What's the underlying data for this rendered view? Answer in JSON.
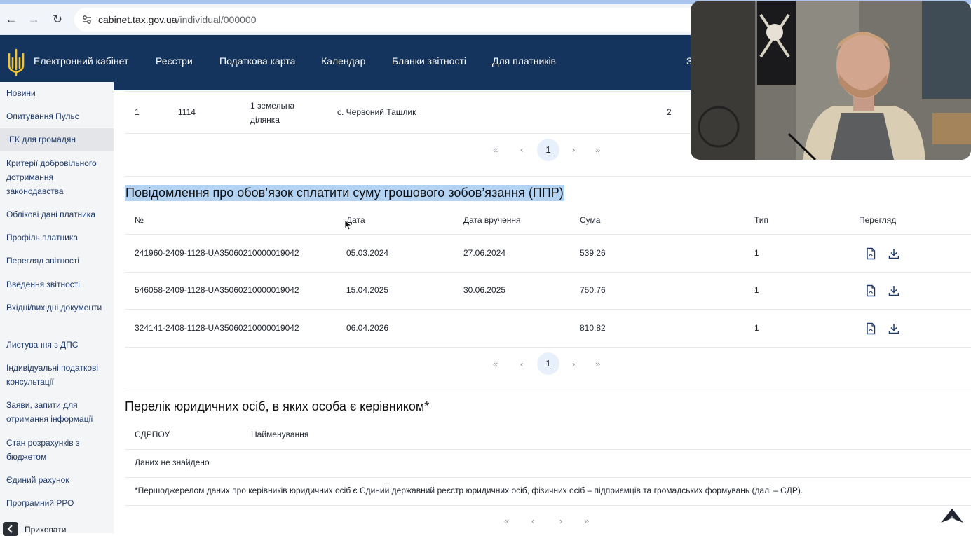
{
  "browser": {
    "url_host": "cabinet.tax.gov.ua",
    "url_path": "/individual/000000"
  },
  "header": {
    "brand": "Електронний кабінет",
    "nav": [
      "Реєстри",
      "Податкова карта",
      "Календар",
      "Бланки звітності",
      "Для платників"
    ],
    "cut_char": "З"
  },
  "sidebar": {
    "items": [
      "Новини",
      "Опитування Пульс",
      "ЕК для громадян",
      "Критерії добровільного дотримання законодавства",
      "Облікові дані платника",
      "Профіль платника",
      "Перегляд звітності",
      "Введення звітності",
      "Вхідні/вихідні документи",
      "Листування з ДПС",
      "Індивідуальні податкові консультації",
      "Заяви, запити для отримання інформації",
      "Стан розрахунків з бюджетом",
      "Єдиний рахунок",
      "Програмний РРО"
    ],
    "active_index": 2,
    "hide_label": "Приховати"
  },
  "land_table": {
    "row": [
      "1",
      "1114",
      "1 земельна ділянка",
      "с. Червоний Ташлик",
      "2"
    ],
    "page": "1"
  },
  "ppr": {
    "title": "Повідомлення про обов’язок сплатити суму грошового зобов’язання (ППР)",
    "headers": [
      "№",
      "Дата",
      "Дата вручення",
      "Сума",
      "Тип",
      "Перегляд"
    ],
    "rows": [
      [
        "241960-2409-1128-UA35060210000019042",
        "05.03.2024",
        "27.06.2024",
        "539.26",
        "1"
      ],
      [
        "546058-2409-1128-UA35060210000019042",
        "15.04.2025",
        "30.06.2025",
        "750.76",
        "1"
      ],
      [
        "324141-2408-1128-UA35060210000019042",
        "06.04.2026",
        "",
        "810.82",
        "1"
      ]
    ],
    "page": "1"
  },
  "entities": {
    "title": "Перелік юридичних осіб, в яких особа є керівником*",
    "headers": [
      "ЄДРПОУ",
      "Найменування"
    ],
    "empty": "Даних не знайдено",
    "footnote": "*Першоджерелом даних про керівників юридичних осіб є Єдиний державний реєстр юридичних осіб, фізичних осіб – підприємців та громадських формувань (далі – ЄДР)."
  },
  "pager_glyphs": {
    "first": "«",
    "prev": "‹",
    "next": "›",
    "last": "»"
  },
  "colors": {
    "header_bg": "#14345d",
    "sidebar_bg": "#f4f5f7",
    "highlight": "#b3d3f5",
    "accent_gold": "#f4c430"
  },
  "icons": [
    "back-arrow-icon",
    "forward-arrow-icon",
    "reload-icon",
    "site-settings-icon",
    "trident-logo-icon",
    "pdf-document-icon",
    "download-icon",
    "sidebar-toggle-icon"
  ]
}
